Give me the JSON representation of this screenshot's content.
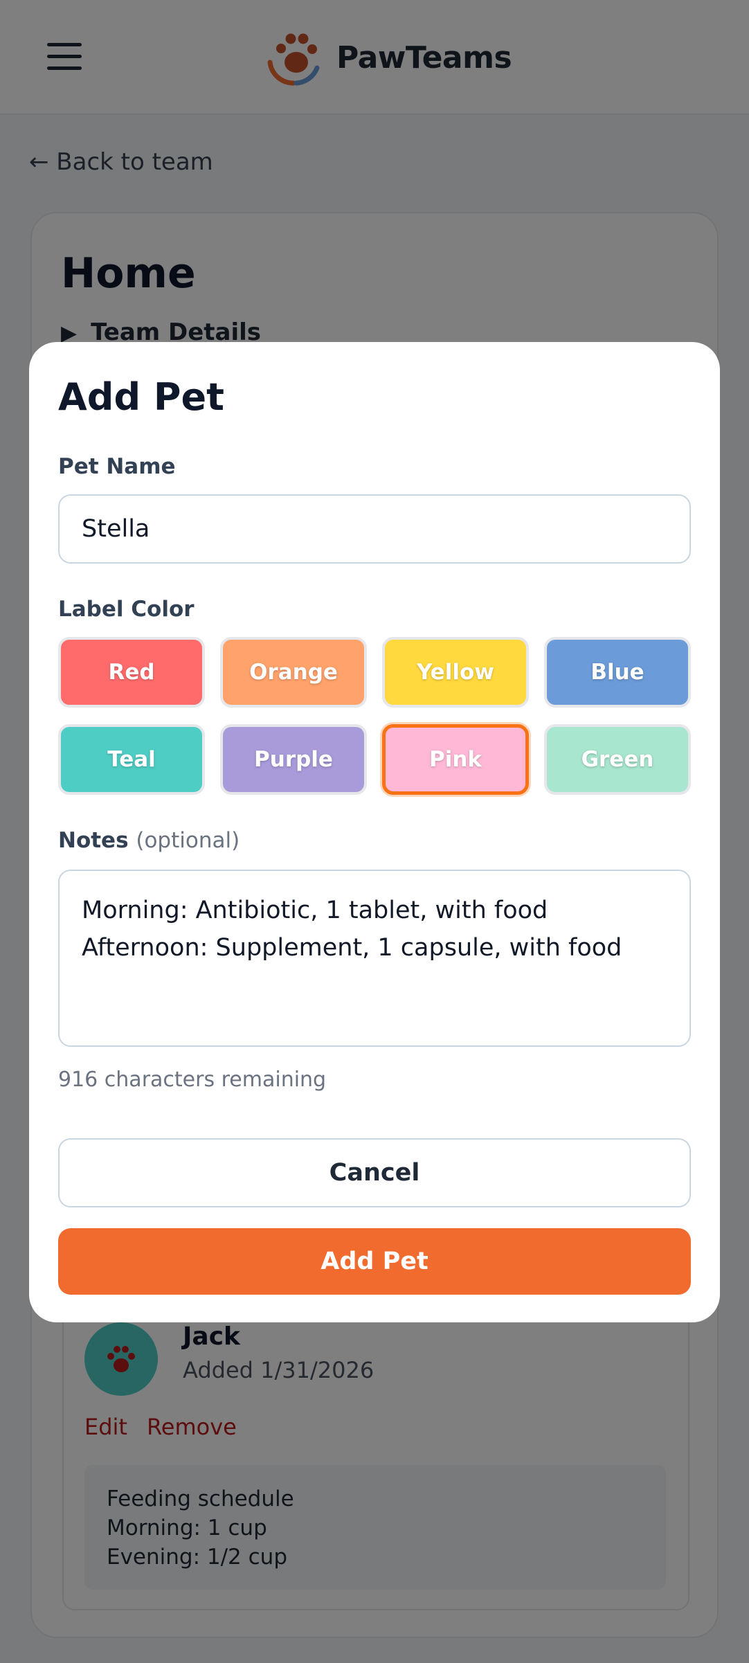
{
  "header": {
    "app_name": "PawTeams",
    "menu_icon": "hamburger-menu-icon",
    "logo_icon": "paw-logo-icon"
  },
  "back_link": "← Back to team",
  "team": {
    "title": "Home",
    "details_toggle": "Team Details"
  },
  "pet_card": {
    "name": "Jack",
    "added": "Added 1/31/2026",
    "edit_label": "Edit",
    "remove_label": "Remove",
    "notes": [
      "Feeding schedule",
      "Morning: 1 cup",
      "Evening: 1/2 cup"
    ],
    "avatar_color": "#4ecdc4"
  },
  "modal": {
    "title": "Add Pet",
    "pet_name_label": "Pet Name",
    "pet_name_value": "Stella",
    "label_color_label": "Label Color",
    "colors": [
      {
        "label": "Red",
        "hex": "#ff6b6b",
        "selected": false
      },
      {
        "label": "Orange",
        "hex": "#ffa26b",
        "selected": false
      },
      {
        "label": "Yellow",
        "hex": "#ffd93d",
        "selected": false
      },
      {
        "label": "Blue",
        "hex": "#6b9bd8",
        "selected": false
      },
      {
        "label": "Teal",
        "hex": "#4ecdc4",
        "selected": false
      },
      {
        "label": "Purple",
        "hex": "#a99ada",
        "selected": false
      },
      {
        "label": "Pink",
        "hex": "#ffb8d6",
        "selected": true
      },
      {
        "label": "Green",
        "hex": "#a8e6cf",
        "selected": false
      }
    ],
    "notes_label": "Notes",
    "notes_optional": "(optional)",
    "notes_value": "Morning: Antibiotic, 1 tablet, with food\nAfternoon: Supplement, 1 capsule, with food",
    "char_remaining": "916 characters remaining",
    "cancel_label": "Cancel",
    "submit_label": "Add Pet"
  },
  "colors": {
    "accent": "#f26b2e",
    "selected_border": "#f97316",
    "danger_text": "#b91c1c"
  }
}
